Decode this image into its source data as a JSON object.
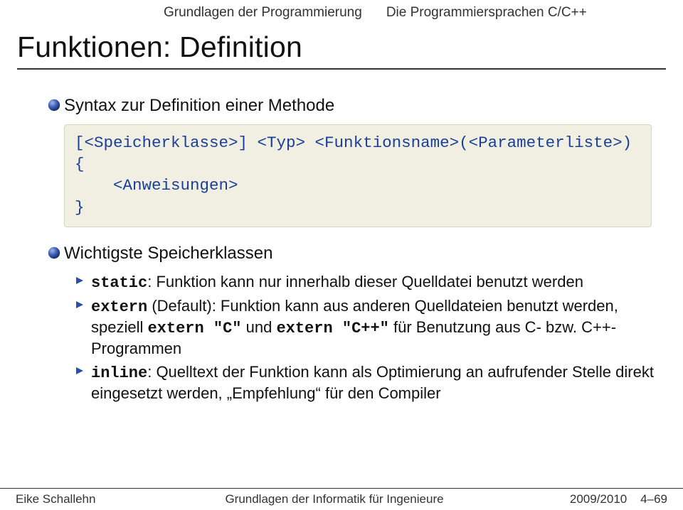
{
  "breadcrumb": {
    "section": "Grundlagen der Programmierung",
    "subsection": "Die Programmiersprachen C/C++"
  },
  "title": "Funktionen: Definition",
  "bullets": {
    "b1": "Syntax zur Definition einer Methode",
    "code": "[<Speicherklasse>] <Typ> <Funktionsname>(<Parameterliste>)\n{\n    <Anweisungen>\n}",
    "b2": "Wichtigste Speicherklassen",
    "sub": {
      "s1_kw": "static",
      "s1_rest": ": Funktion kann nur innerhalb dieser Quelldatei benutzt werden",
      "s2_kw": "extern",
      "s2_mid": " (Default): Funktion kann aus anderen Quelldateien benutzt werden, speziell ",
      "s2_code1": "extern \"C\"",
      "s2_and": " und ",
      "s2_code2": "extern \"C++\"",
      "s2_tail": " für Benutzung aus C- bzw. C++-Programmen",
      "s3_kw": "inline",
      "s3_rest": ": Quelltext der Funktion kann als Optimierung an aufrufender Stelle direkt eingesetzt werden, „Empfehlung“ für den Compiler"
    }
  },
  "footer": {
    "author": "Eike Schallehn",
    "center": "Grundlagen der Informatik für Ingenieure",
    "term": "2009/2010",
    "page": "4–69"
  }
}
